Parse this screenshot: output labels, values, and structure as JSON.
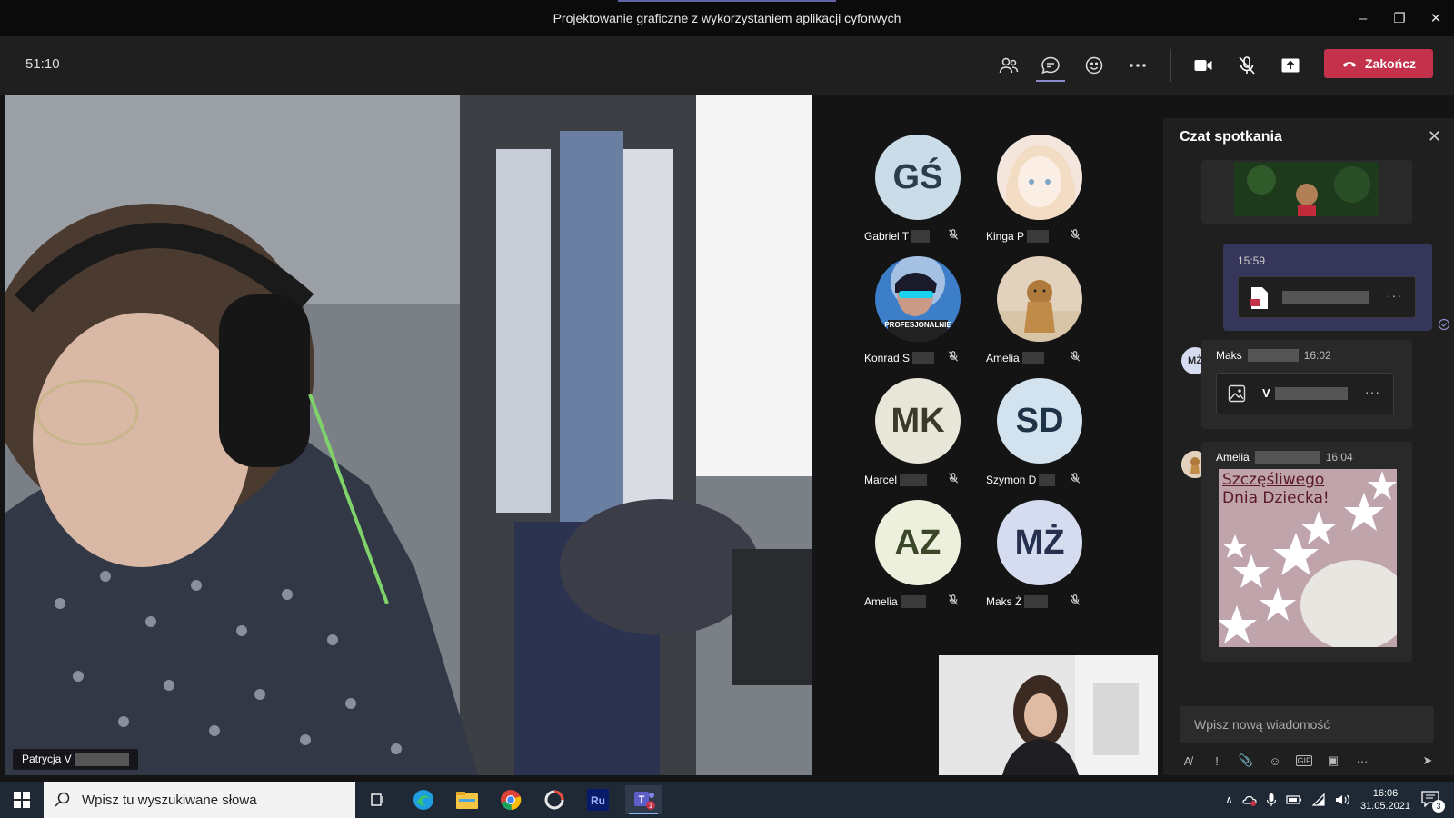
{
  "window": {
    "title": "Projektowanie graficzne z wykorzystaniem aplikacji cyforwych"
  },
  "toolbar": {
    "timer": "51:10",
    "end_label": "Zakończ"
  },
  "main_video": {
    "participant_name": "Patrycja V"
  },
  "participants": [
    {
      "initials": "GŚ",
      "name": "Gabriel T",
      "avatar_bg": "#c9dce8",
      "type": "initials"
    },
    {
      "initials": "",
      "name": "Kinga P",
      "avatar_bg": "#f2e3d8",
      "type": "image"
    },
    {
      "initials": "",
      "name": "Konrad S",
      "avatar_bg": "#4a8fd4",
      "type": "image",
      "overlay_text": "PROFESJONALNIE"
    },
    {
      "initials": "",
      "name": "Amelia",
      "avatar_bg": "#d9c4a8",
      "type": "image"
    },
    {
      "initials": "MK",
      "name": "Marcel",
      "avatar_bg": "#e8e6d8",
      "type": "initials"
    },
    {
      "initials": "SD",
      "name": "Szymon D",
      "avatar_bg": "#d2e2ee",
      "type": "initials"
    },
    {
      "initials": "AZ",
      "name": "Amelia",
      "avatar_bg": "#ecf0dc",
      "type": "initials"
    },
    {
      "initials": "MŻ",
      "name": "Maks Ż",
      "avatar_bg": "#d6dcf0",
      "type": "initials"
    }
  ],
  "chat": {
    "header": "Czat spotkania",
    "own_message": {
      "time": "15:59"
    },
    "messages": [
      {
        "author": "Maks",
        "initials": "MŻ",
        "time": "16:02",
        "file_prefix": "V"
      },
      {
        "author": "Amelia",
        "time": "16:04",
        "image_text": "Szczęśliwego Dnia Dziecka!"
      }
    ],
    "input_placeholder": "Wpisz nową wiadomość"
  },
  "taskbar": {
    "search_placeholder": "Wpisz tu wyszukiwane słowa",
    "clock_time": "16:06",
    "clock_date": "31.05.2021",
    "notifications_count": "3",
    "teams_badge": "1"
  },
  "colors": {
    "end_call": "#c4314b",
    "accent": "#6264a7",
    "own_msg_bg": "#35365a"
  }
}
